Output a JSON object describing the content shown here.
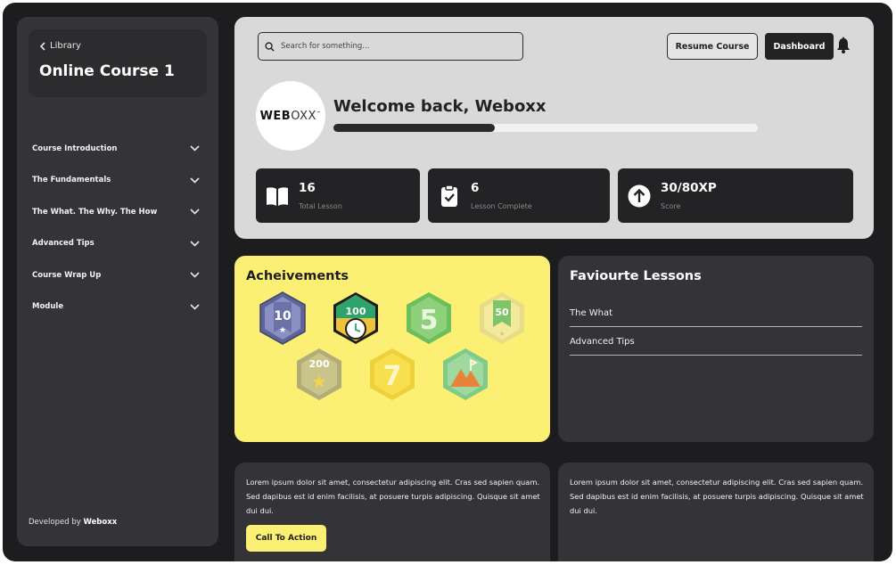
{
  "sidebar": {
    "back_label": "Library",
    "course_title": "Online Course 1",
    "items": [
      {
        "label": "Course Introduction"
      },
      {
        "label": "The Fundamentals"
      },
      {
        "label": "The What. The Why. The How"
      },
      {
        "label": "Advanced Tips"
      },
      {
        "label": "Course Wrap Up"
      },
      {
        "label": "Module"
      }
    ],
    "credit_prefix": "Developed by",
    "credit_name": "Weboxx"
  },
  "header": {
    "search_placeholder": "Search for something...",
    "resume_label": "Resume Course",
    "dashboard_label": "Dashboard",
    "icons": [
      "search-icon",
      "bell-icon"
    ]
  },
  "profile": {
    "logo_main": "WEB",
    "logo_tail": "OXX",
    "logo_tm": "™",
    "welcome": "Welcome back, Weboxx",
    "progress_fraction": 0.38
  },
  "stats": [
    {
      "value": "16",
      "label": "Total Lesson",
      "icon": "book-icon"
    },
    {
      "value": "6",
      "label": "Lesson Complete",
      "icon": "clipboard-check-icon"
    },
    {
      "value": "30/80XP",
      "label": "Score",
      "icon": "arrow-up-circle-icon"
    }
  ],
  "achievements": {
    "title": "Acheivements",
    "badges": [
      {
        "text": "10",
        "icon": "badge-10-icon",
        "color": "#7b83b8"
      },
      {
        "text": "100",
        "icon": "badge-100-icon",
        "color": "#2fa36b"
      },
      {
        "text": "5",
        "icon": "badge-5-icon",
        "color": "#8fd17a"
      },
      {
        "text": "50",
        "icon": "badge-50-icon",
        "color": "#f1e79a"
      },
      {
        "text": "200",
        "icon": "badge-200-icon",
        "color": "#c9c48a"
      },
      {
        "text": "7",
        "icon": "badge-7-icon",
        "color": "#f7df4e"
      },
      {
        "text": "",
        "icon": "badge-mountain-icon",
        "color": "#9fd9a0"
      }
    ]
  },
  "favourites": {
    "title": "Faviourte Lessons",
    "items": [
      {
        "label": "The What"
      },
      {
        "label": "Advanced Tips"
      }
    ]
  },
  "cards": [
    {
      "text": "Lorem ipsum dolor sit amet, consectetur adipiscing elit. Cras sed sapien quam. Sed dapibus est id enim facilisis, at posuere turpis adipiscing. Quisque sit amet dui dui.",
      "cta": "Call To Action"
    },
    {
      "text": "Lorem ipsum dolor sit amet, consectetur adipiscing elit. Cras sed sapien quam. Sed dapibus est id enim facilisis, at posuere turpis adipiscing. Quisque sit amet dui dui."
    }
  ],
  "colors": {
    "background": "#1d1d1f",
    "panel_dark": "#343438",
    "panel_light": "#d9d9d9",
    "accent_yellow": "#fbef74"
  }
}
